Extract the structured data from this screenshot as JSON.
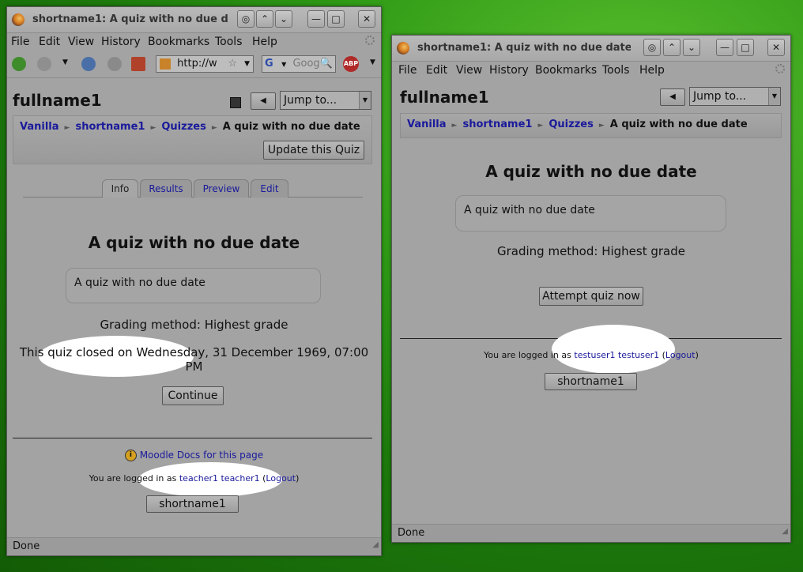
{
  "left_window": {
    "title": "shortname1: A quiz with no due d",
    "menu": [
      "File",
      "Edit",
      "View",
      "History",
      "Bookmarks",
      "Tools",
      "Help"
    ],
    "url": "http://w",
    "search_placeholder": "Goog",
    "page_heading": "fullname1",
    "jump_label": "Jump to...",
    "breadcrumb": {
      "site": "Vanilla",
      "course": "shortname1",
      "module": "Quizzes",
      "current": "A quiz with no due date"
    },
    "update_button": "Update this Quiz",
    "tabs": [
      "Info",
      "Results",
      "Preview",
      "Edit"
    ],
    "quiz_title": "A quiz with no due date",
    "quiz_summary": "A quiz with no due date",
    "grading": "Grading method: Highest grade",
    "closed_line1": "This quiz closed on Wednesday, 31 December 1969, 07:00",
    "closed_line2": "PM",
    "continue_button": "Continue",
    "docs_link": "Moodle Docs for this page",
    "logged_prefix": "You are logged in as",
    "user": "teacher1 teacher1",
    "logout": "Logout",
    "course_button": "shortname1",
    "status": "Done"
  },
  "right_window": {
    "title": "shortname1: A quiz with no due date -",
    "menu": [
      "File",
      "Edit",
      "View",
      "History",
      "Bookmarks",
      "Tools",
      "Help"
    ],
    "page_heading": "fullname1",
    "jump_label": "Jump to...",
    "breadcrumb": {
      "site": "Vanilla",
      "course": "shortname1",
      "module": "Quizzes",
      "current": "A quiz with no due date"
    },
    "quiz_title": "A quiz with no due date",
    "quiz_summary": "A quiz with no due date",
    "grading": "Grading method: Highest grade",
    "attempt_button": "Attempt quiz now",
    "logged_prefix": "You are logged in as",
    "user": "testuser1 testuser1",
    "logout": "Logout",
    "course_button": "shortname1",
    "status": "Done"
  },
  "colors": {
    "link": "#1a1a9c",
    "desktop": "#2f9a16",
    "window": "#a3a3a3"
  }
}
